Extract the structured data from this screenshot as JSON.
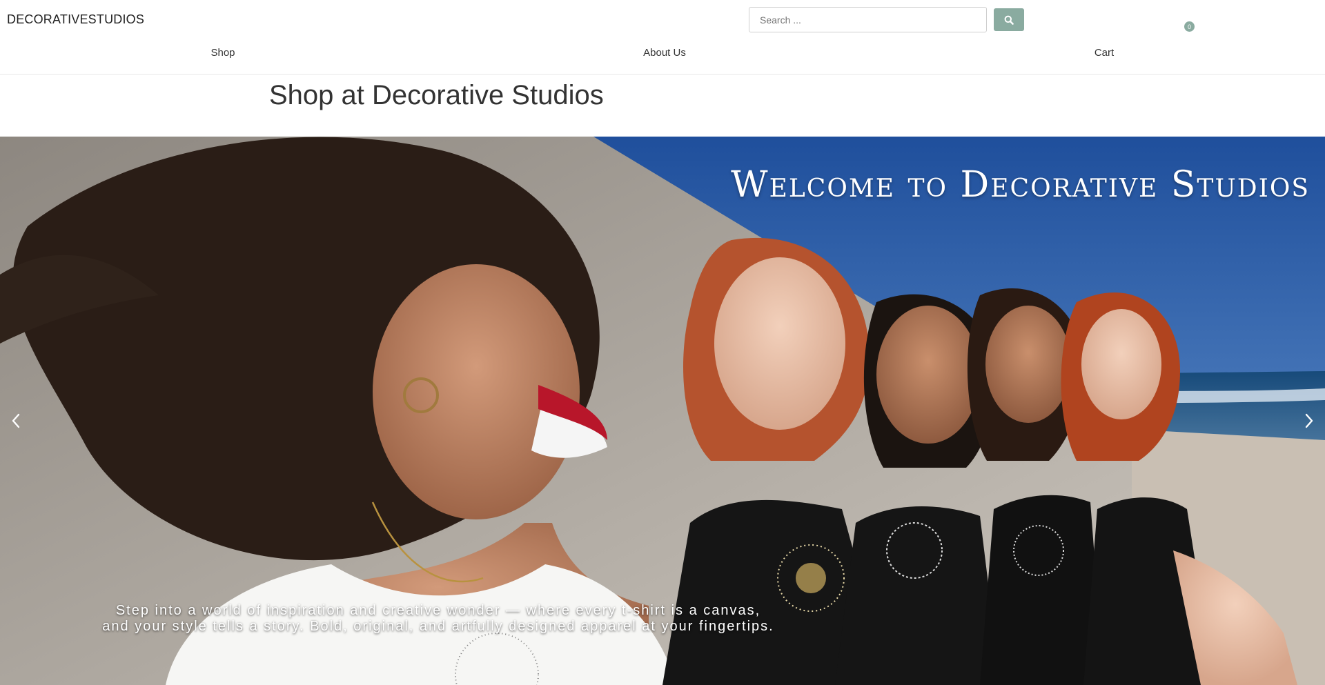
{
  "header": {
    "brand": "DECORATIVESTUDIOS",
    "search": {
      "placeholder": "Search ...",
      "button_icon": "search-icon"
    },
    "cart": {
      "count": "0"
    }
  },
  "nav": {
    "items": [
      {
        "label": "Shop"
      },
      {
        "label": "About Us"
      },
      {
        "label": "Cart"
      }
    ]
  },
  "main": {
    "title": "Shop at Decorative Studios"
  },
  "hero": {
    "title": "Welcome to Decorative Studios",
    "caption_line1": "Step into a world of inspiration and creative wonder — where every t-shirt is a canvas,",
    "caption_line2": "and your style tells a story. Bold, original, and artfully designed apparel at your fingertips.",
    "prev_icon": "chevron-left-icon",
    "next_icon": "chevron-right-icon"
  },
  "colors": {
    "accent": "#8aaba0",
    "text": "#333333",
    "sky": "#2f5fa8",
    "wall": "#a39d95"
  }
}
